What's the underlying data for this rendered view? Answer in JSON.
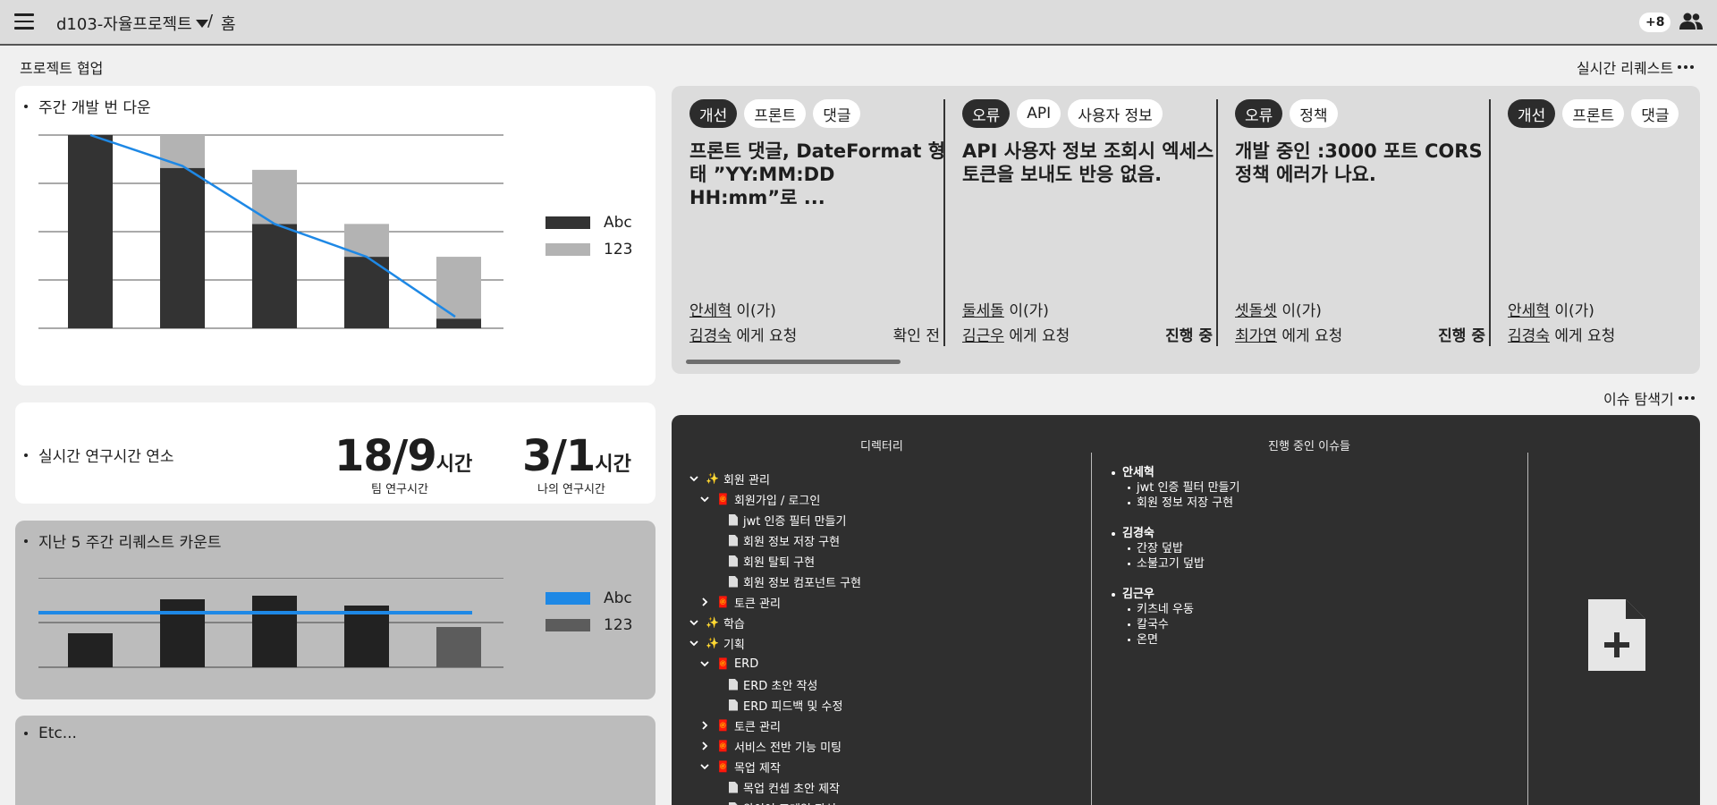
{
  "topbar": {
    "project": "d103-자율프로젝트",
    "separator": "/",
    "page": "홈",
    "member_badge": "+8"
  },
  "sections": {
    "collab_title": "프로젝트 협업",
    "realtime_request": "실시간 리퀘스트",
    "issue_explorer": "이슈 탐색기"
  },
  "burndown": {
    "label": "주간 개발 번 다운",
    "legend": [
      {
        "name": "Abc",
        "color": "#333333"
      },
      {
        "name": "123",
        "color": "#b3b3b3"
      }
    ]
  },
  "overtime": {
    "label": "실시간 연구시간 연소",
    "team_value": "18/9",
    "team_unit": "시간",
    "team_caption": "팀 연구시간",
    "my_value": "3/1",
    "my_unit": "시간",
    "my_caption": "나의 연구시간"
  },
  "request_count": {
    "label": "지난 5 주간 리퀘스트 카운트",
    "legend": [
      {
        "name": "Abc",
        "color": "#1e88e5"
      },
      {
        "name": "123",
        "color": "#5c5c5c"
      }
    ]
  },
  "etc": {
    "label": "Etc..."
  },
  "requests": [
    {
      "tags": [
        {
          "t": "개선",
          "dark": true
        },
        {
          "t": "프론트",
          "dark": false
        },
        {
          "t": "댓글",
          "dark": false
        }
      ],
      "title": "프론트 댓글, DateFormat 형태 ”YY:MM:DD HH:mm”로 ...",
      "from": "안세혁",
      "from_suffix": " 이(가)",
      "to": "김경숙",
      "to_suffix": " 에게 요청",
      "status": "확인 전",
      "status_bold": false
    },
    {
      "tags": [
        {
          "t": "오류",
          "dark": true
        },
        {
          "t": "API",
          "dark": false
        },
        {
          "t": "사용자 정보",
          "dark": false
        }
      ],
      "title": "API 사용자 정보 조회시 엑세스 토큰을 보내도 반응 없음.",
      "from": "둘세돌",
      "from_suffix": " 이(가)",
      "to": "김근우",
      "to_suffix": " 에게 요청",
      "status": "진행 중",
      "status_bold": true
    },
    {
      "tags": [
        {
          "t": "오류",
          "dark": true
        },
        {
          "t": "정책",
          "dark": false
        }
      ],
      "title": "개발 중인 :3000 포트 CORS 정책 에러가 나요.",
      "from": "셋돌셋",
      "from_suffix": " 이(가)",
      "to": "최가연",
      "to_suffix": " 에게 요청",
      "status": "진행 중",
      "status_bold": true
    },
    {
      "tags": [
        {
          "t": "개선",
          "dark": true
        },
        {
          "t": "프론트",
          "dark": false
        },
        {
          "t": "댓글",
          "dark": false
        }
      ],
      "title": "",
      "from": "안세혁",
      "from_suffix": " 이(가)",
      "to": "김경숙",
      "to_suffix": " 에게 요청",
      "status": "",
      "status_bold": false
    }
  ],
  "explorer": {
    "col_directory": "디렉터리",
    "col_issues": "진행 중인 이슈들",
    "tree": [
      {
        "depth": 0,
        "kind": "folder",
        "open": true,
        "icon": "✨",
        "label": "회원 관리"
      },
      {
        "depth": 1,
        "kind": "folder",
        "open": true,
        "icon": "🧧",
        "label": "회원가입 / 로그인"
      },
      {
        "depth": 2,
        "kind": "file",
        "label": "jwt 인증 필터 만들기"
      },
      {
        "depth": 2,
        "kind": "file",
        "label": "회원 정보 저장 구현"
      },
      {
        "depth": 2,
        "kind": "file",
        "label": "회원 탈퇴 구현"
      },
      {
        "depth": 2,
        "kind": "file",
        "label": "회원 정보 컴포넌트 구현"
      },
      {
        "depth": 1,
        "kind": "folder",
        "open": false,
        "icon": "🧧",
        "label": "토큰 관리"
      },
      {
        "depth": 0,
        "kind": "folder",
        "open": true,
        "icon": "✨",
        "label": "학습"
      },
      {
        "depth": 0,
        "kind": "folder",
        "open": true,
        "icon": "✨",
        "label": "기획"
      },
      {
        "depth": 1,
        "kind": "folder",
        "open": true,
        "icon": "🧧",
        "label": "ERD"
      },
      {
        "depth": 2,
        "kind": "file",
        "label": "ERD 초안 작성"
      },
      {
        "depth": 2,
        "kind": "file",
        "label": "ERD 피드백 및 수정"
      },
      {
        "depth": 1,
        "kind": "folder",
        "open": false,
        "icon": "🧧",
        "label": "토큰 관리"
      },
      {
        "depth": 1,
        "kind": "folder",
        "open": false,
        "icon": "🧧",
        "label": "서비스 전반 기능 미팅"
      },
      {
        "depth": 1,
        "kind": "folder",
        "open": true,
        "icon": "🧧",
        "label": "목업 제작"
      },
      {
        "depth": 2,
        "kind": "file",
        "label": "목업 컨셉 초안 제작"
      },
      {
        "depth": 2,
        "kind": "file",
        "label": "와이어 프레임 작성"
      }
    ],
    "assignees": [
      {
        "name": "안세혁",
        "issues": [
          "jwt 인증 필터 만들기",
          "회원 정보 저장 구현"
        ]
      },
      {
        "name": "김경숙",
        "issues": [
          "간장 덮밥",
          "소불고기 덮밥"
        ]
      },
      {
        "name": "김근우",
        "issues": [
          "키츠네 우동",
          "칼국수",
          "온면"
        ]
      }
    ]
  },
  "chart_data": [
    {
      "type": "bar",
      "title": "",
      "categories": [
        "",
        "",
        "",
        "",
        ""
      ],
      "series": [
        {
          "name": "Abc",
          "values": [
            100,
            83,
            54,
            37,
            5
          ],
          "stacked": true
        },
        {
          "name": "123",
          "values": [
            0,
            17,
            28,
            17,
            32
          ],
          "stacked": true
        },
        {
          "name": "",
          "type": "line",
          "values": [
            100,
            84,
            54,
            37,
            6
          ]
        }
      ],
      "ylim": [
        0,
        100
      ],
      "grid": true,
      "legend": "right"
    },
    {
      "type": "bar",
      "title": "",
      "categories": [
        "",
        "",
        "",
        "",
        ""
      ],
      "series": [
        {
          "name": "123",
          "values": [
            38,
            76,
            80,
            69,
            45
          ]
        },
        {
          "name": "Abc",
          "type": "line",
          "values": [
            61,
            61,
            61,
            61,
            61
          ]
        }
      ],
      "ylim": [
        0,
        100
      ],
      "grid": true,
      "legend": "right"
    }
  ]
}
